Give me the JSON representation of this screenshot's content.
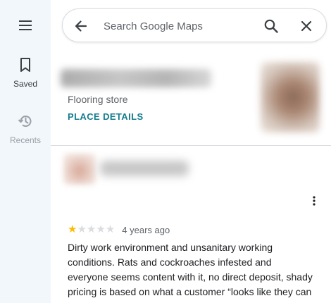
{
  "rail": {
    "menu_icon": "menu-icon",
    "saved": {
      "label": "Saved",
      "icon": "bookmark-icon"
    },
    "recents": {
      "label": "Recents",
      "icon": "history-icon"
    }
  },
  "search": {
    "placeholder": "Search Google Maps",
    "value": "",
    "back_icon": "arrow-left-icon",
    "search_icon": "search-icon",
    "clear_icon": "close-icon"
  },
  "place": {
    "category": "Flooring store",
    "details_link": "PLACE DETAILS"
  },
  "review": {
    "rating": 1,
    "max_rating": 5,
    "date": "4 years ago",
    "text": "Dirty work environment and unsanitary working conditions. Rats and cockroaches infested and everyone seems content with it, no direct deposit, shady pricing is based on what a customer “looks like they can afford”. This place has been dead with fake"
  },
  "colors": {
    "accent": "#137c8e",
    "star": "#fbbc04",
    "rail_bg": "#f1f7fb"
  }
}
